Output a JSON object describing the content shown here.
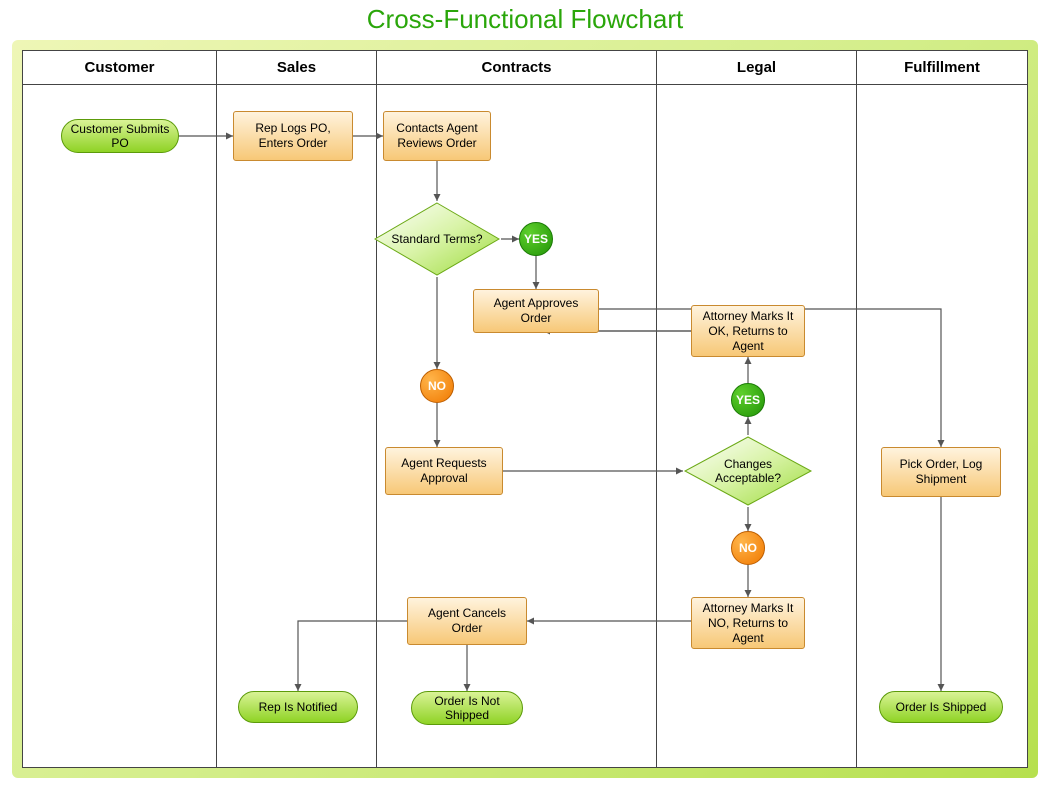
{
  "title": "Cross-Functional Flowchart",
  "lanes": {
    "customer": "Customer",
    "sales": "Sales",
    "contracts": "Contracts",
    "legal": "Legal",
    "fulfillment": "Fulfillment"
  },
  "nodes": {
    "customer_submits_po": "Customer Submits PO",
    "rep_logs_po": "Rep Logs PO, Enters Order",
    "contacts_agent_reviews": "Contacts Agent Reviews Order",
    "standard_terms": "Standard Terms?",
    "agent_approves_order": "Agent Approves Order",
    "agent_requests_approval": "Agent Requests Approval",
    "agent_cancels_order": "Agent Cancels Order",
    "changes_acceptable": "Changes Acceptable?",
    "attorney_ok": "Attorney Marks It OK, Returns to Agent",
    "attorney_no": "Attorney Marks It NO, Returns to Agent",
    "pick_order_log_shipment": "Pick Order, Log Shipment",
    "rep_is_notified": "Rep Is Notified",
    "order_not_shipped": "Order Is Not Shipped",
    "order_is_shipped": "Order Is Shipped"
  },
  "branch": {
    "yes": "YES",
    "no": "NO"
  }
}
